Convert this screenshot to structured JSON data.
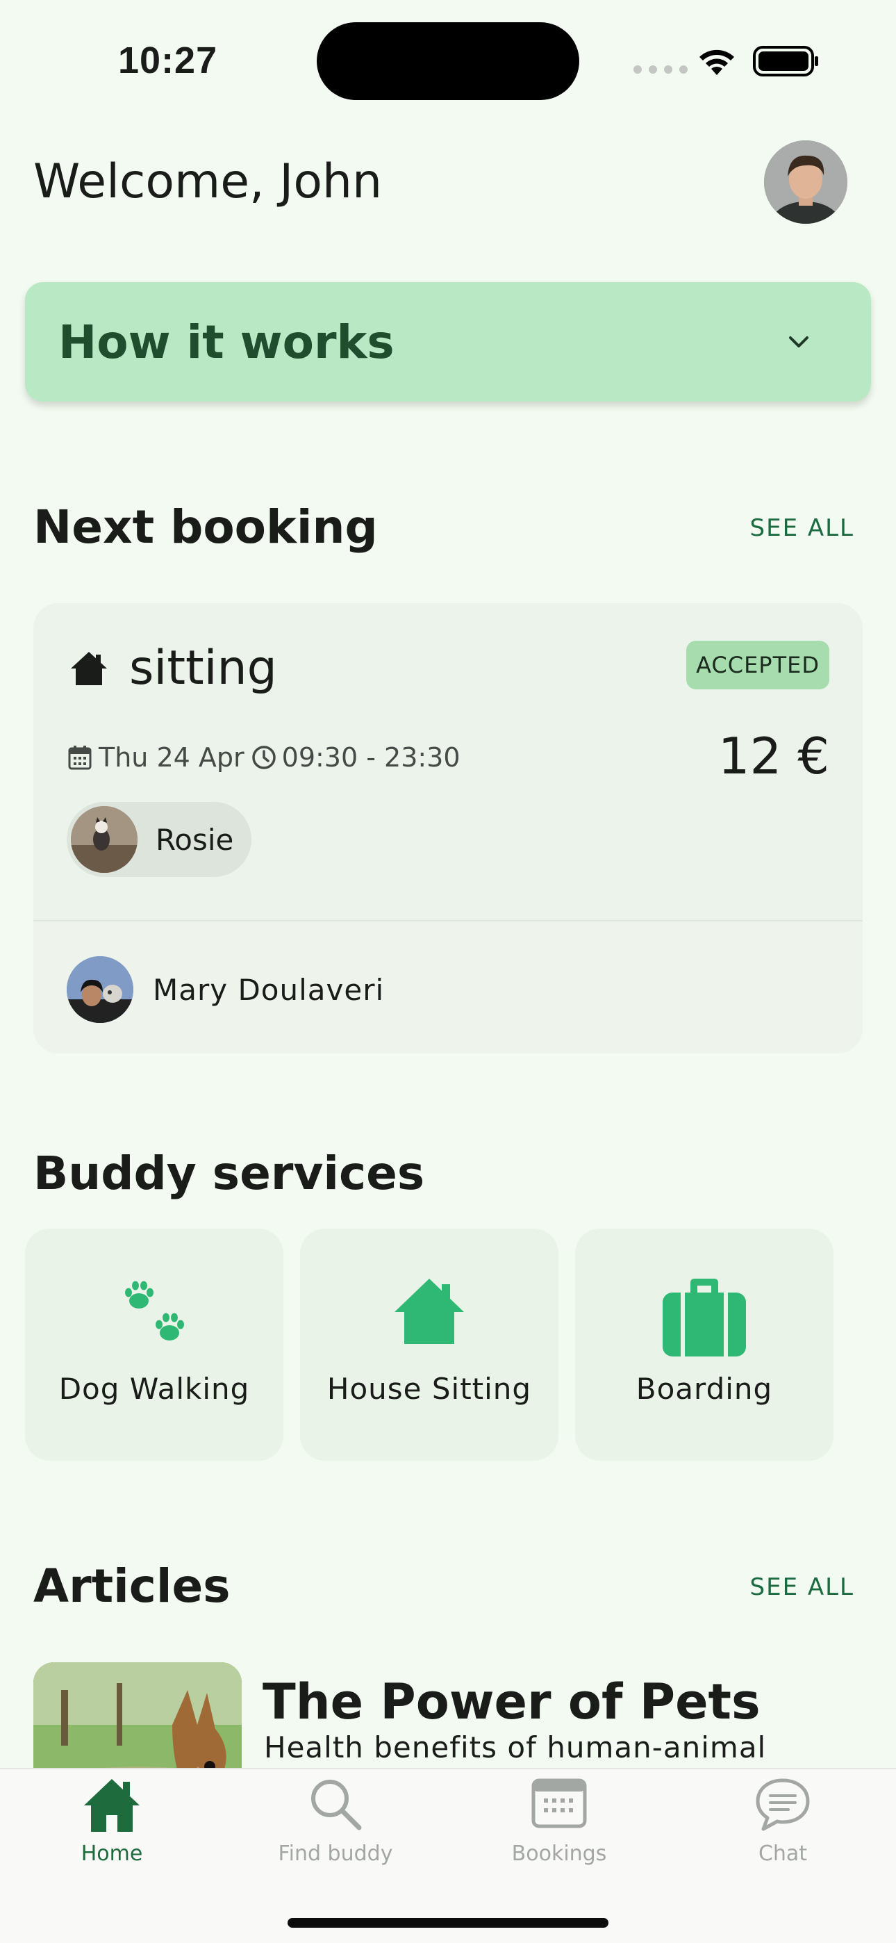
{
  "status_bar": {
    "time": "10:27"
  },
  "header": {
    "welcome": "Welcome, John"
  },
  "how_it_works": {
    "title": "How it works"
  },
  "next_booking": {
    "section_title": "Next booking",
    "see_all": "SEE ALL",
    "service_label": "sitting",
    "status": "ACCEPTED",
    "date": "Thu 24 Apr",
    "time_range": "09:30 - 23:30",
    "price": "12 €",
    "pet_name": "Rosie",
    "sitter_name": "Mary Doulaveri"
  },
  "buddy_services": {
    "section_title": "Buddy services",
    "items": [
      {
        "label": "Dog Walking",
        "icon": "paw-icon"
      },
      {
        "label": "House Sitting",
        "icon": "house-icon"
      },
      {
        "label": "Boarding",
        "icon": "suitcase-icon"
      }
    ]
  },
  "articles": {
    "section_title": "Articles",
    "see_all": "SEE ALL",
    "items": [
      {
        "title": "The Power of Pets",
        "subtitle": "Health benefits of human-animal"
      }
    ]
  },
  "bottom_nav": {
    "items": [
      {
        "label": "Home",
        "icon": "home-icon",
        "active": true
      },
      {
        "label": "Find buddy",
        "icon": "search-icon",
        "active": false
      },
      {
        "label": "Bookings",
        "icon": "calendar-icon",
        "active": false
      },
      {
        "label": "Chat",
        "icon": "chat-icon",
        "active": false
      }
    ]
  },
  "colors": {
    "background": "#f2faf1",
    "accent_green": "#2fb874",
    "dark_green": "#1e6b3e",
    "how_card": "#b9e9c4",
    "badge": "#a6dcae"
  }
}
